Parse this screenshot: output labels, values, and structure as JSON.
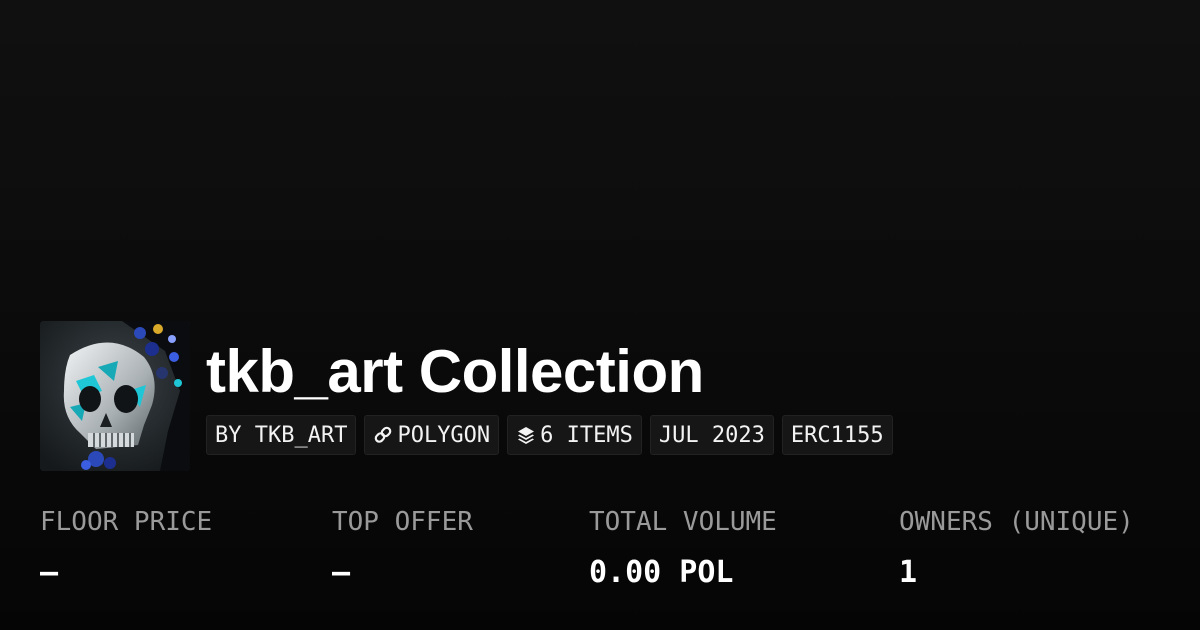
{
  "collection": {
    "title": "tkb_art Collection",
    "chips": {
      "creator": "BY TKB_ART",
      "chain": "POLYGON",
      "items": "6 ITEMS",
      "date": "JUL 2023",
      "standard": "ERC1155"
    },
    "chip_icons": {
      "chain": "link-icon",
      "items": "layers-icon"
    },
    "avatar_icon": "skull-artwork"
  },
  "stats": {
    "floor_price": {
      "label": "FLOOR PRICE",
      "value": "–"
    },
    "top_offer": {
      "label": "TOP OFFER",
      "value": "–"
    },
    "total_volume": {
      "label": "TOTAL VOLUME",
      "value": "0.00 POL"
    },
    "owners": {
      "label": "OWNERS (UNIQUE)",
      "value": "1"
    }
  },
  "colors": {
    "background": "#0c0c0c",
    "chip_background": "#161616",
    "label_gray": "#9a9a9a",
    "accent_cyan": "#1fc7d6"
  }
}
